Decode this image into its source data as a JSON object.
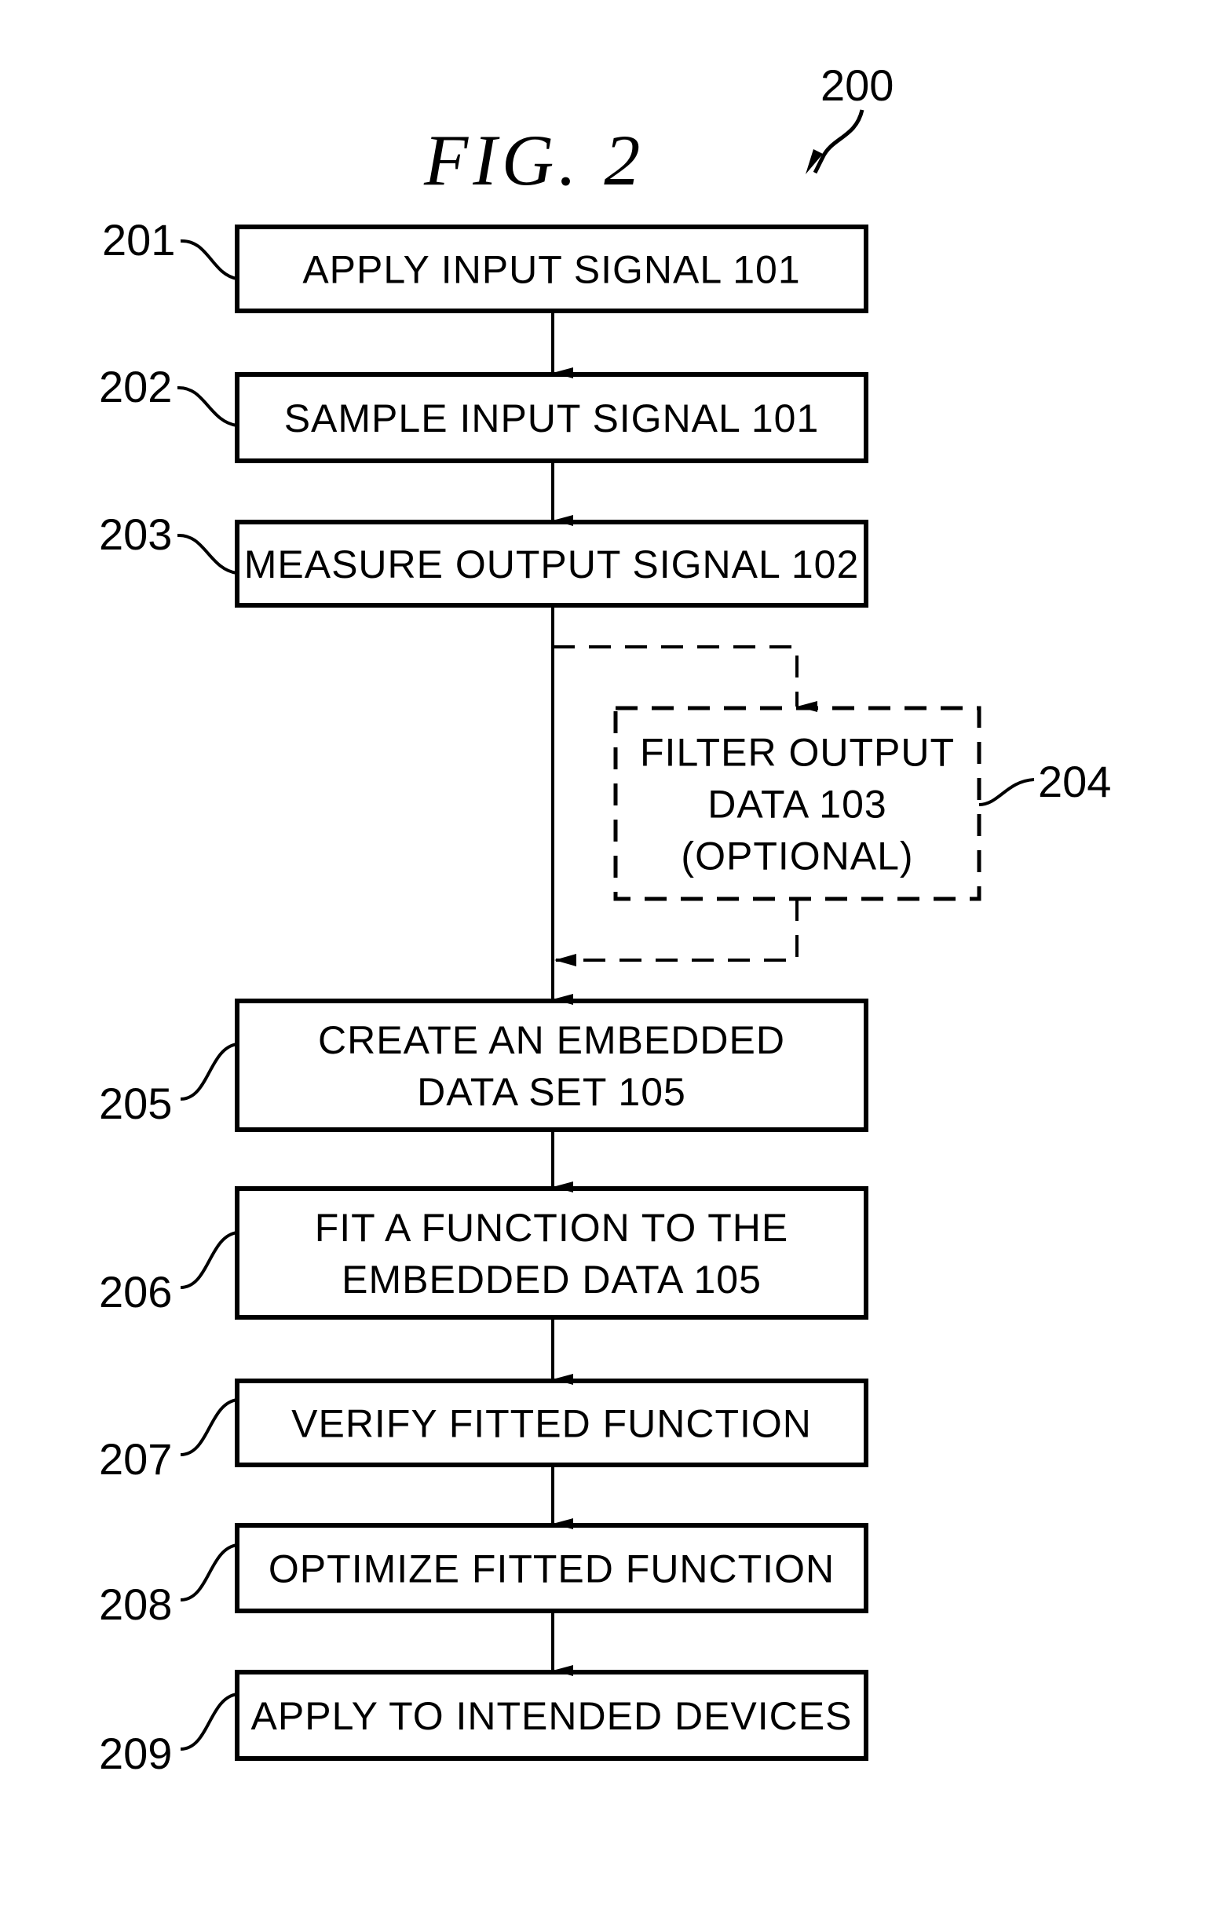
{
  "figure": {
    "title": "FIG.  2",
    "reference": "200"
  },
  "steps": [
    {
      "ref": "201",
      "lines": [
        "APPLY  INPUT  SIGNAL  101"
      ],
      "optional": false
    },
    {
      "ref": "202",
      "lines": [
        "SAMPLE  INPUT  SIGNAL  101"
      ],
      "optional": false
    },
    {
      "ref": "203",
      "lines": [
        "MEASURE  OUTPUT  SIGNAL  102"
      ],
      "optional": false
    },
    {
      "ref": "204",
      "lines": [
        "FILTER  OUTPUT",
        "DATA  103",
        "(OPTIONAL)"
      ],
      "optional": true
    },
    {
      "ref": "205",
      "lines": [
        "CREATE  AN  EMBEDDED",
        "DATA  SET  105"
      ],
      "optional": false
    },
    {
      "ref": "206",
      "lines": [
        "FIT  A  FUNCTION  TO  THE",
        "EMBEDDED  DATA  105"
      ],
      "optional": false
    },
    {
      "ref": "207",
      "lines": [
        "VERIFY  FITTED  FUNCTION"
      ],
      "optional": false
    },
    {
      "ref": "208",
      "lines": [
        "OPTIMIZE  FITTED  FUNCTION"
      ],
      "optional": false
    },
    {
      "ref": "209",
      "lines": [
        "APPLY  TO  INTENDED  DEVICES"
      ],
      "optional": false
    }
  ],
  "colors": {
    "ink": "#000000",
    "paper": "#ffffff"
  }
}
